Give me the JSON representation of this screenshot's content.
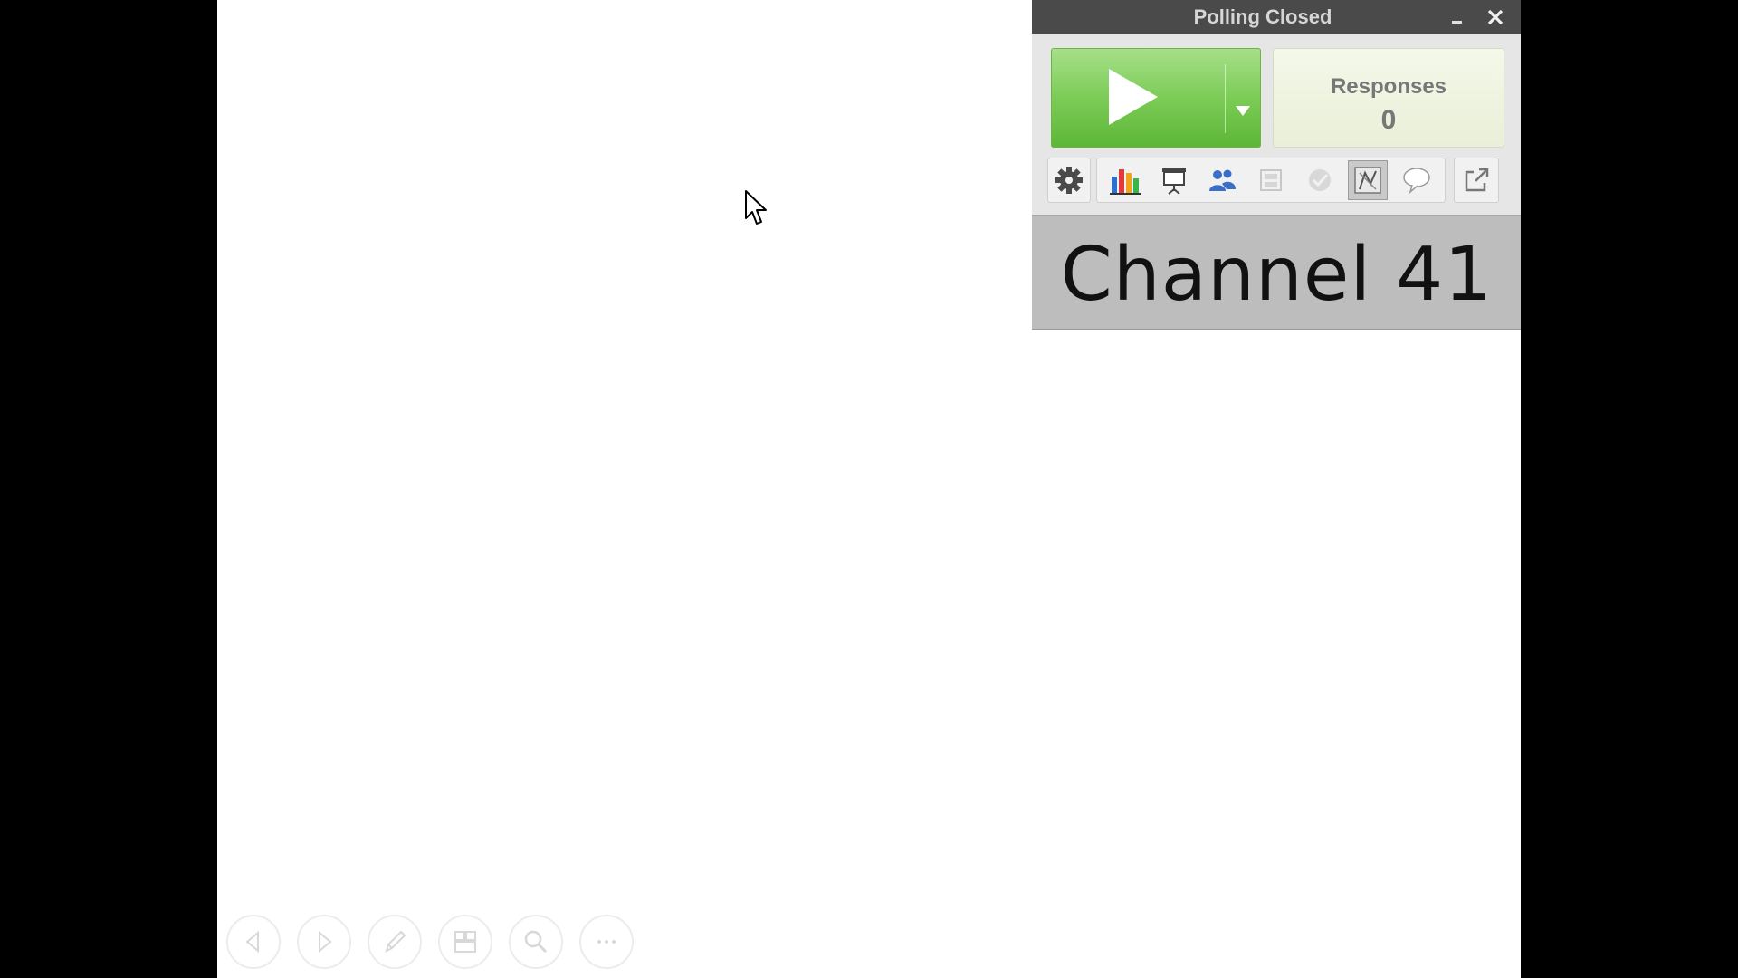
{
  "poll_widget": {
    "title": "Polling Closed",
    "start_button_icon": "play-icon",
    "responses": {
      "label": "Responses",
      "count": "0"
    },
    "tools": [
      "gear-icon",
      "bar-chart-icon",
      "presentation-icon",
      "participants-icon",
      "grid-icon",
      "check-icon",
      "chart-view-icon",
      "speech-bubble-icon",
      "export-icon"
    ],
    "channel": "Channel 41",
    "colors": {
      "start_green": "#7ccc57",
      "titlebar": "#4a4a4a"
    }
  },
  "presenter_toolbar": {
    "buttons": [
      "previous-icon",
      "next-icon",
      "pen-icon",
      "slides-icon",
      "zoom-icon",
      "more-icon"
    ]
  }
}
